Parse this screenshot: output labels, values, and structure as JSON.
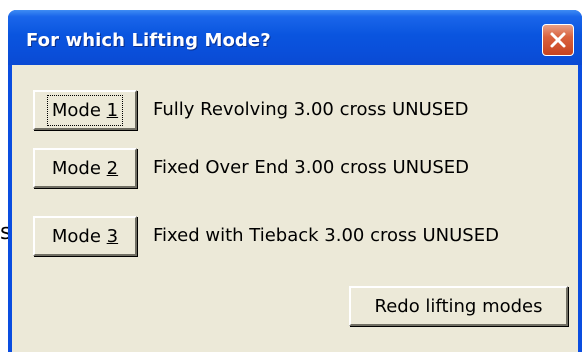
{
  "background": {
    "partial_glyph": "s"
  },
  "dialog": {
    "title": "For which Lifting Mode?",
    "close_icon": "close-x-icon",
    "colors": {
      "titlebar": "#0a55df",
      "client": "#ece9d8",
      "close": "#d9623e"
    }
  },
  "modes": [
    {
      "prefix": "Mode ",
      "number": "1",
      "description": "Fully Revolving 3.00 cross UNUSED",
      "focused": true
    },
    {
      "prefix": "Mode ",
      "number": "2",
      "description": "Fixed Over End 3.00 cross UNUSED",
      "focused": false
    },
    {
      "prefix": "Mode ",
      "number": "3",
      "description": "Fixed with Tieback 3.00 cross UNUSED",
      "focused": false
    }
  ],
  "redo_button_label": "Redo lifting modes"
}
